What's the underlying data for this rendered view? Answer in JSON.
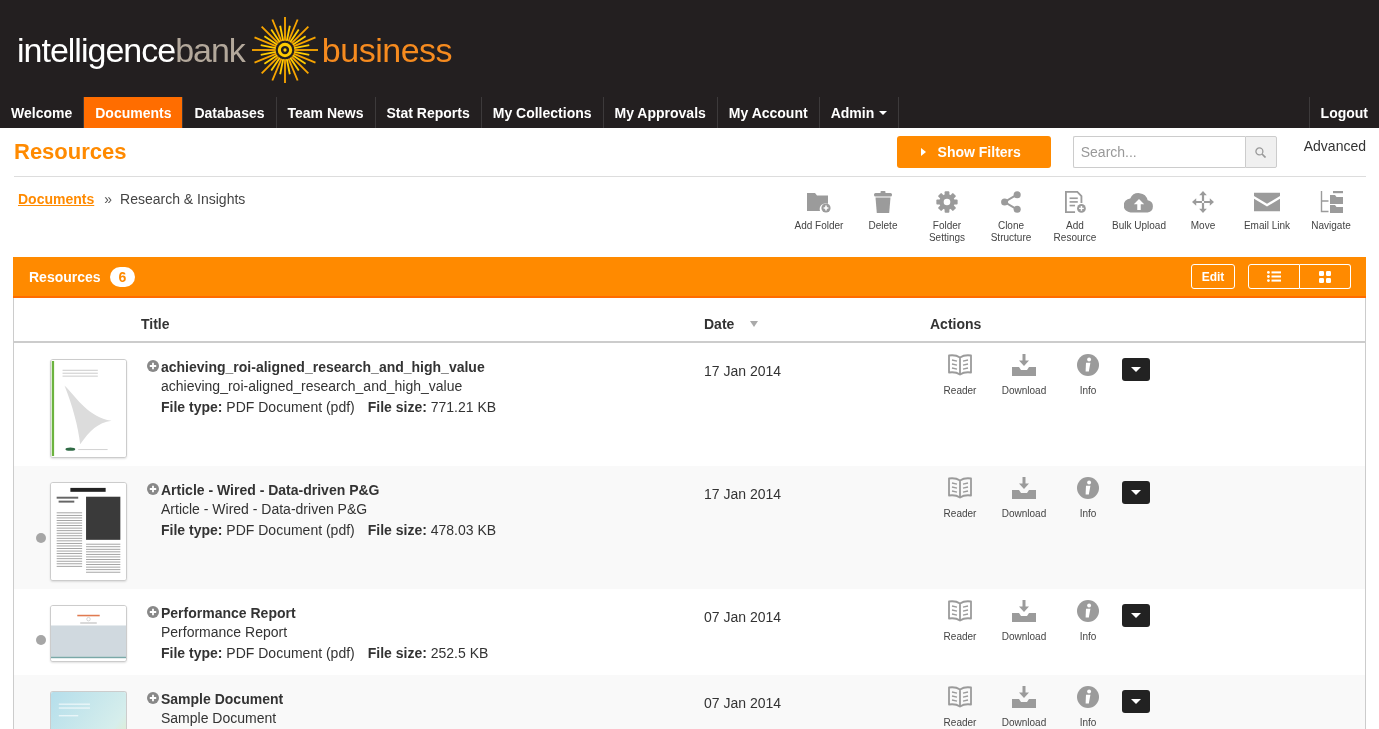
{
  "header": {
    "logo": {
      "wordmark": [
        "intelligence",
        "bank"
      ],
      "tagline": "business"
    }
  },
  "nav": {
    "tabs": [
      {
        "label": "Welcome",
        "selected": false,
        "has_menu": false
      },
      {
        "label": "Documents",
        "selected": true,
        "has_menu": false
      },
      {
        "label": "Databases",
        "selected": false,
        "has_menu": false
      },
      {
        "label": "Team News",
        "selected": false,
        "has_menu": false
      },
      {
        "label": "Stat Reports",
        "selected": false,
        "has_menu": false
      },
      {
        "label": "My Collections",
        "selected": false,
        "has_menu": false
      },
      {
        "label": "My Approvals",
        "selected": false,
        "has_menu": false
      },
      {
        "label": "My Account",
        "selected": false,
        "has_menu": false
      },
      {
        "label": "Admin",
        "selected": false,
        "has_menu": true
      }
    ],
    "logout": "Logout"
  },
  "page": {
    "title": "Resources",
    "filter_button": "Show Filters",
    "search": {
      "placeholder": "Search..."
    },
    "advanced_link": "Advanced"
  },
  "breadcrumb": {
    "link": "Documents",
    "separator": "»",
    "current": "Research & Insights"
  },
  "toolbar": [
    {
      "label": "Add Folder",
      "kind": "folder-plus"
    },
    {
      "label": "Delete",
      "kind": "trash"
    },
    {
      "label": "Folder Settings",
      "kind": "gear"
    },
    {
      "label": "Clone Structure",
      "kind": "share"
    },
    {
      "label": "Add Resource",
      "kind": "document-plus"
    },
    {
      "label": "Bulk Upload",
      "kind": "cloud-upload"
    },
    {
      "label": "Move",
      "kind": "move"
    },
    {
      "label": "Email Link",
      "kind": "envelope"
    },
    {
      "label": "Navigate",
      "kind": "folder-tree"
    }
  ],
  "panel": {
    "title": "Resources",
    "count": "6",
    "edit_button": "Edit",
    "views": [
      {
        "kind": "list"
      },
      {
        "kind": "grid"
      }
    ]
  },
  "table": {
    "columns": [
      {
        "label": "Title",
        "sorted": false
      },
      {
        "label": "Date",
        "sorted": true
      },
      {
        "label": "Actions",
        "sorted": false
      }
    ],
    "rows": [
      {
        "status_dot": false,
        "thumbnail": {
          "kind": "cover"
        },
        "title": "achieving_roi-aligned_research_and_high_value",
        "subtitle": "achieving_roi-aligned_research_and_high_value",
        "file_type": "**File type:** PDF Document (pdf)",
        "file_size": "**File size:** 771.21 KB",
        "date": "17 Jan 2014",
        "actions": [
          {
            "label": "Reader",
            "kind": "book"
          },
          {
            "label": "Download",
            "kind": "download"
          },
          {
            "label": "Info",
            "kind": "info"
          }
        ]
      },
      {
        "status_dot": true,
        "thumbnail": {
          "kind": "article"
        },
        "title": "Article - Wired - Data-driven P&G",
        "subtitle": "Article - Wired - Data-driven P&G",
        "file_type": "**File type:** PDF Document (pdf)",
        "file_size": "**File size:** 478.03 KB",
        "date": "17 Jan 2014",
        "actions": [
          {
            "label": "Reader",
            "kind": "book"
          },
          {
            "label": "Download",
            "kind": "download"
          },
          {
            "label": "Info",
            "kind": "info"
          }
        ]
      },
      {
        "status_dot": true,
        "thumbnail": {
          "kind": "report"
        },
        "title": "Performance Report",
        "subtitle": "Performance Report",
        "file_type": "**File type:** PDF Document (pdf)",
        "file_size": "**File size:** 252.5 KB",
        "date": "07 Jan 2014",
        "actions": [
          {
            "label": "Reader",
            "kind": "book"
          },
          {
            "label": "Download",
            "kind": "download"
          },
          {
            "label": "Info",
            "kind": "info"
          }
        ]
      },
      {
        "status_dot": false,
        "thumbnail": {
          "kind": "template"
        },
        "title": "Sample Document",
        "subtitle": "Sample Document",
        "date": "07 Jan 2014",
        "actions": [
          {
            "label": "Reader",
            "kind": "book"
          },
          {
            "label": "Download",
            "kind": "download"
          },
          {
            "label": "Info",
            "kind": "info"
          }
        ]
      }
    ]
  }
}
